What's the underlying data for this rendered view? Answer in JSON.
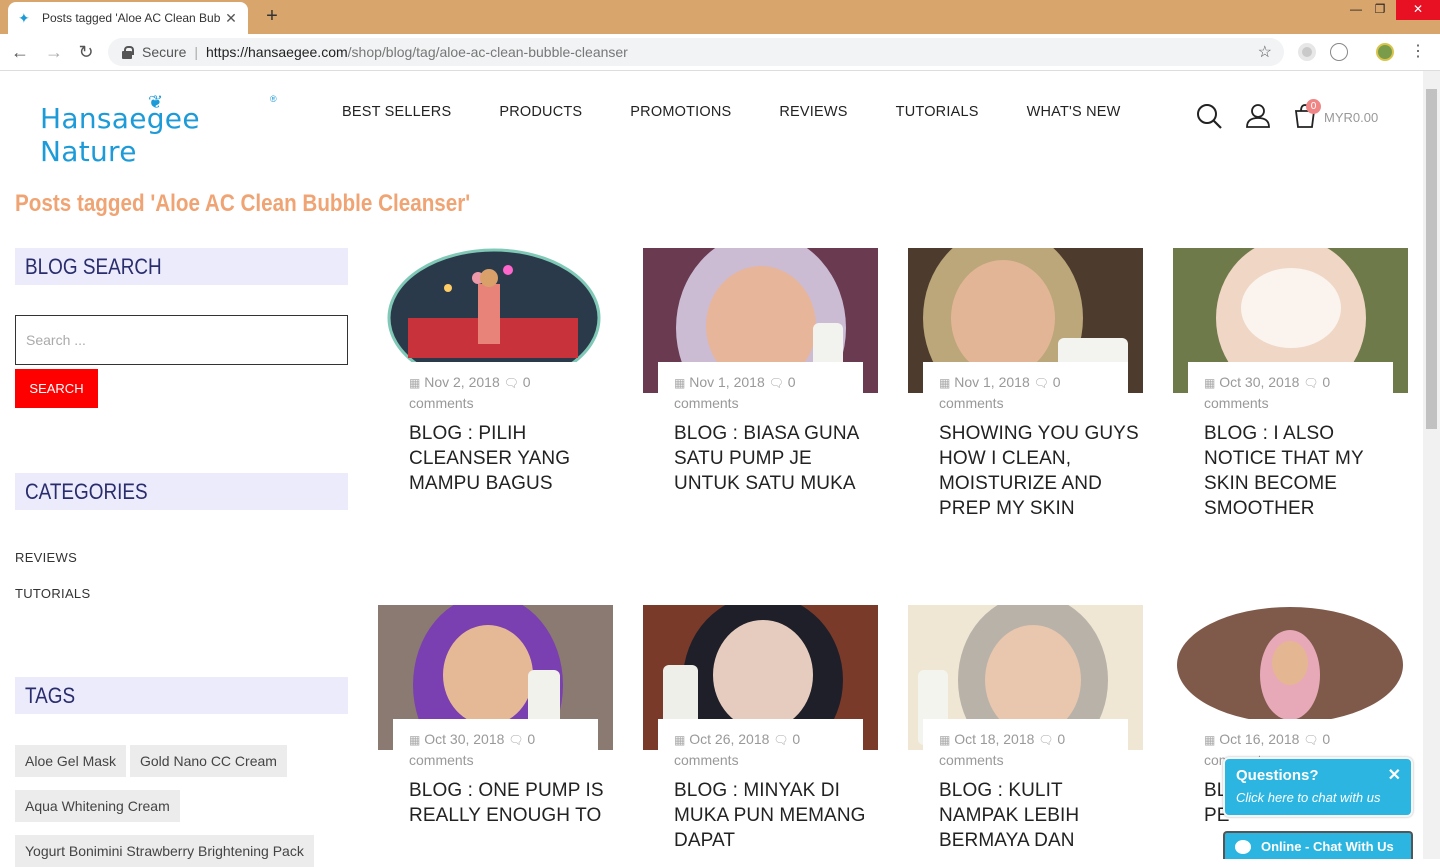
{
  "browser": {
    "tab_title": "Posts tagged 'Aloe AC Clean Bub",
    "secure_label": "Secure",
    "url_host": "https://hansaegee.com",
    "url_path": "/shop/blog/tag/aloe-ac-clean-bubble-cleanser"
  },
  "site": {
    "logo_text": "Hansaegee Nature",
    "nav": [
      "BEST SELLERS",
      "PRODUCTS",
      "PROMOTIONS",
      "REVIEWS",
      "TUTORIALS",
      "WHAT'S NEW"
    ],
    "cart_count": "0",
    "cart_total": "MYR0.00"
  },
  "page_title": "Posts tagged 'Aloe AC Clean Bubble Cleanser'",
  "sidebar": {
    "blog_search_heading": "BLOG SEARCH",
    "search_placeholder": "Search ...",
    "search_button": "SEARCH",
    "categories_heading": "CATEGORIES",
    "categories": [
      "REVIEWS",
      "TUTORIALS"
    ],
    "tags_heading": "TAGS",
    "tags": [
      "Aloe Gel Mask",
      "Gold Nano CC Cream",
      "Aqua Whitening Cream",
      "Yogurt Bonimini Strawberry Brightening Pack"
    ]
  },
  "posts": [
    {
      "date": "Nov 2, 2018",
      "comments": "0",
      "comments_word": "comments",
      "title": "BLOG : PILIH CLEANSER YANG MAMPU BAGUS"
    },
    {
      "date": "Nov 1, 2018",
      "comments": "0",
      "comments_word": "comments",
      "title": "BLOG : BIASA GUNA SATU PUMP JE UNTUK SATU MUKA"
    },
    {
      "date": "Nov 1, 2018",
      "comments": "0",
      "comments_word": "comments",
      "title": "SHOWING YOU GUYS HOW I CLEAN, MOISTURIZE AND PREP MY SKIN"
    },
    {
      "date": "Oct 30, 2018",
      "comments": "0",
      "comments_word": "comments",
      "title": "BLOG : I ALSO NOTICE THAT MY SKIN BECOME SMOOTHER"
    },
    {
      "date": "Oct 30, 2018",
      "comments": "0",
      "comments_word": "comments",
      "title": "BLOG : ONE PUMP IS REALLY ENOUGH TO"
    },
    {
      "date": "Oct 26, 2018",
      "comments": "0",
      "comments_word": "comments",
      "title": "BLOG : MINYAK DI MUKA PUN MEMANG DAPAT"
    },
    {
      "date": "Oct 18, 2018",
      "comments": "0",
      "comments_word": "comments",
      "title": "BLOG : KULIT NAMPAK LEBIH BERMAYA DAN"
    },
    {
      "date": "Oct 16, 2018",
      "comments": "0",
      "comments_word": "comments",
      "title": "BL THEY ARE BOTH A PE"
    }
  ],
  "chat": {
    "question": "Questions?",
    "prompt": "Click here to chat with us",
    "status": "Online - Chat With Us"
  },
  "colors": {
    "brand_blue": "#1d9bd8",
    "title_orange": "#f0a474",
    "search_red": "#ff0000",
    "chat_blue": "#2cb5e0"
  }
}
